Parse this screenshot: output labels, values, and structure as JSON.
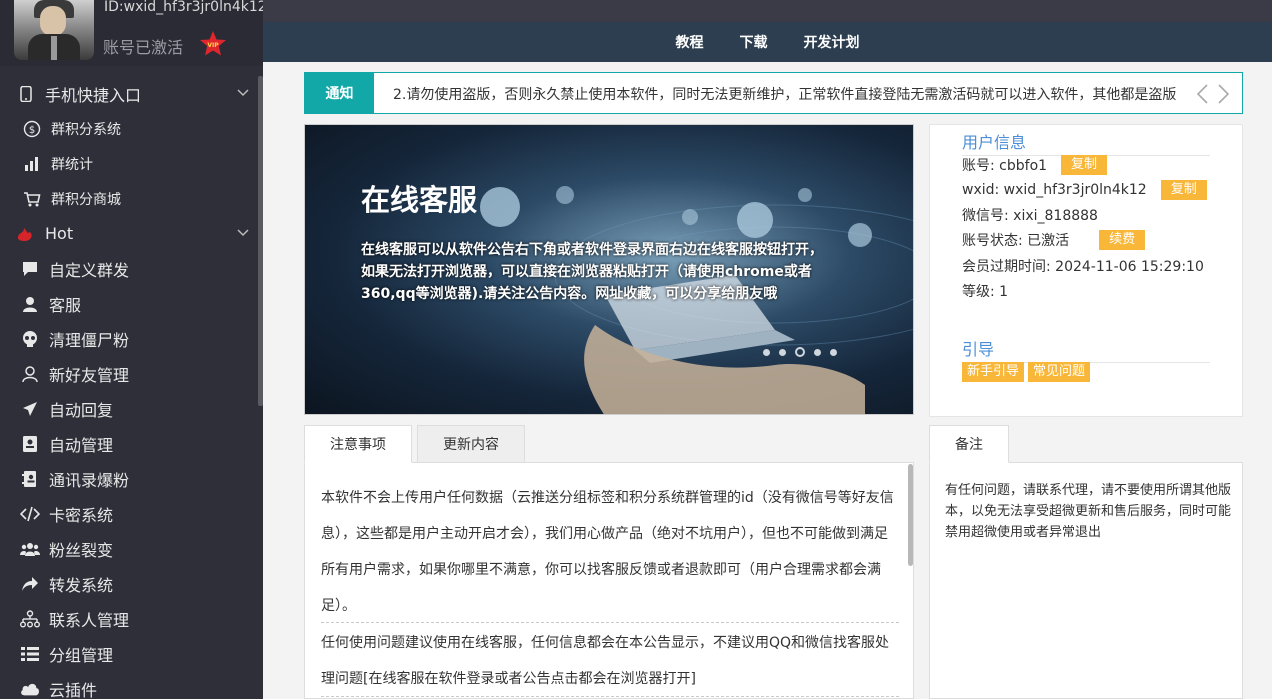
{
  "profile": {
    "id_text": "ID:wxid_hf3r3jr0ln4k12",
    "status": "账号已激活",
    "vip_label": "VIP"
  },
  "sidebar": {
    "items": [
      {
        "label": "手机快捷入口",
        "icon": "mobile-icon",
        "type": "group"
      },
      {
        "label": "群积分系统",
        "icon": "dollar-icon",
        "type": "sub"
      },
      {
        "label": "群统计",
        "icon": "bar-chart-icon",
        "type": "sub"
      },
      {
        "label": "群积分商城",
        "icon": "cart-icon",
        "type": "sub"
      },
      {
        "label": "Hot",
        "icon": "fire-icon",
        "type": "group"
      },
      {
        "label": "自定义群发",
        "icon": "comment-icon",
        "type": "item"
      },
      {
        "label": "客服",
        "icon": "user-icon",
        "type": "item"
      },
      {
        "label": "清理僵尸粉",
        "icon": "skull-icon",
        "type": "item"
      },
      {
        "label": "新好友管理",
        "icon": "person-icon",
        "type": "item"
      },
      {
        "label": "自动回复",
        "icon": "send-icon",
        "type": "item"
      },
      {
        "label": "自动管理",
        "icon": "id-card-icon",
        "type": "item"
      },
      {
        "label": "通讯录爆粉",
        "icon": "address-book-icon",
        "type": "item"
      },
      {
        "label": "卡密系统",
        "icon": "code-icon",
        "type": "item"
      },
      {
        "label": "粉丝裂变",
        "icon": "users-icon",
        "type": "item"
      },
      {
        "label": "转发系统",
        "icon": "share-icon",
        "type": "item"
      },
      {
        "label": "联系人管理",
        "icon": "sitemap-icon",
        "type": "item"
      },
      {
        "label": "分组管理",
        "icon": "list-icon",
        "type": "item"
      },
      {
        "label": "云插件",
        "icon": "cloud-icon",
        "type": "item"
      }
    ]
  },
  "topnav": {
    "links": [
      "教程",
      "下载",
      "开发计划"
    ]
  },
  "notice": {
    "label": "通知",
    "text": "2.请勿使用盗版，否则永久禁止使用本软件，同时无法更新维护，正常软件直接登陆无需激活码就可以进入软件，其他都是盗版"
  },
  "banner": {
    "title": "在线客服",
    "text": "在线客服可以从软件公告右下角或者软件登录界面右边在线客服按钮打开，如果无法打开浏览器，可以直接在浏览器粘贴打开（请使用chrome或者360,qq等浏览器).请关注公告内容。网址收藏，可以分享给朋友哦",
    "dots": 5,
    "active_dot": 3
  },
  "userinfo": {
    "title": "用户信息",
    "account_label": "账号: cbbfo1",
    "wxid_label": "wxid: wxid_hf3r3jr0ln4k12",
    "wechat_label": "微信号: xixi_818888",
    "status_label": "账号状态: 已激活",
    "expire_label": "会员过期时间: 2024-11-06 15:29:10",
    "level_label": "等级: 1",
    "copy_btn": "复制",
    "renew_btn": "续费",
    "guide_title": "引导",
    "guide_btn_1": "新手引导",
    "guide_btn_2": "常见问题"
  },
  "notes": {
    "tab_1": "注意事项",
    "tab_2": "更新内容",
    "para_1": "本软件不会上传用户任何数据（云推送分组标签和积分系统群管理的id（没有微信号等好友信息），这些都是用户主动开启才会），我们用心做产品（绝对不坑用户），但也不可能做到满足所有用户需求，如果你哪里不满意，你可以找客服反馈或者退款即可（用户合理需求都会满足）。",
    "para_2": "任何使用问题建议使用在线客服，任何信息都会在本公告显示，不建议用QQ和微信找客服处理问题[在线客服在软件登录或者公告点击都会在浏览器打开]"
  },
  "remark": {
    "tab": "备注",
    "text": "有任何问题，请联系代理，请不要使用所谓其他版本，以免无法享受超微更新和售后服务，同时可能禁用超微使用或者异常退出"
  }
}
